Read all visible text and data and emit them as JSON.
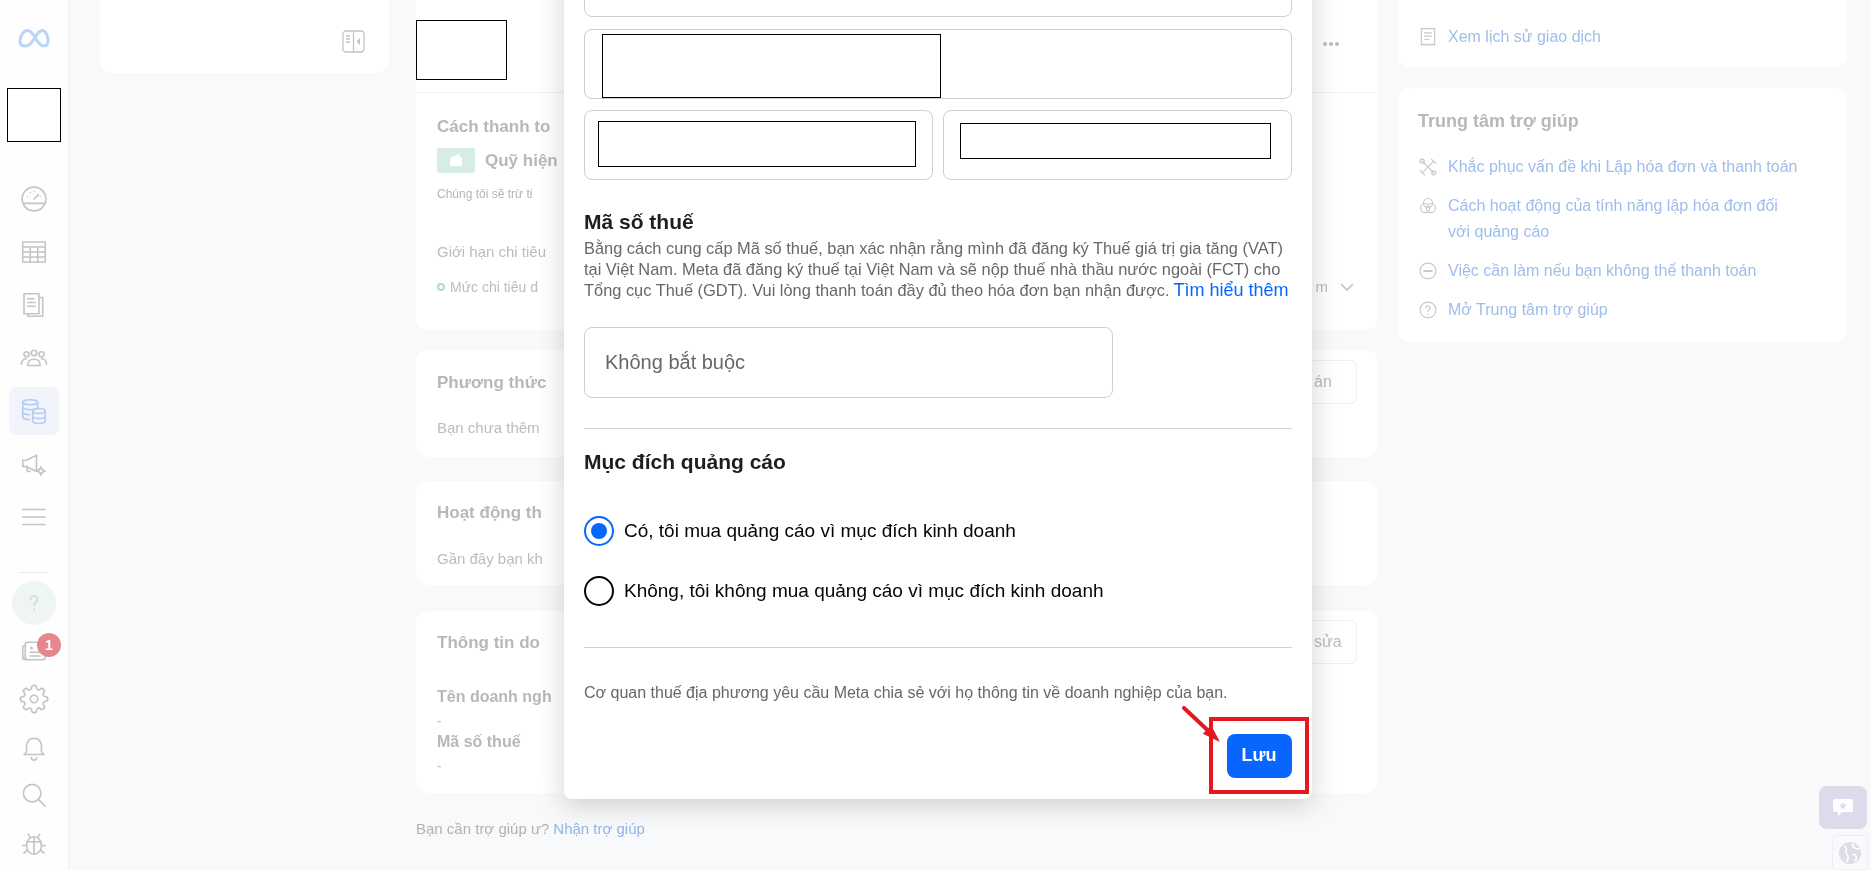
{
  "sidebar": {
    "nav_items": [
      {
        "selected": false
      },
      {
        "selected": false
      },
      {
        "selected": false
      },
      {
        "selected": false
      },
      {
        "selected": true
      },
      {
        "selected": false
      },
      {
        "selected": false
      }
    ],
    "tool_items": [
      {
        "selected": false
      },
      {
        "selected": false,
        "badge": "1"
      },
      {
        "selected": false
      },
      {
        "selected": false
      },
      {
        "selected": false
      },
      {
        "selected": false
      }
    ]
  },
  "main": {
    "payment_card": {
      "title": "Cách thanh to",
      "fund": "Quỹ hiện",
      "note": "Chúng tôi sẽ trừ ti",
      "limit_label": "Giới hạn chi tiêu",
      "spend": "Mức chi tiêu d",
      "spend_end": "m"
    },
    "payment_methods_card": {
      "title": "Phương thức",
      "text": "Bạn chưa thêm",
      "button": "án"
    },
    "activity_card": {
      "title": "Hoạt động th",
      "text": "Gần đây bạn kh"
    },
    "business_card": {
      "title": "Thông tin do",
      "button": "sửa",
      "fields": [
        {
          "label": "Tên doanh ngh",
          "value": "-"
        },
        {
          "label": "Mã số thuế",
          "value": "-"
        }
      ]
    },
    "help_prompt": {
      "text": "Bạn cần trợ giúp ư?",
      "link": "Nhận trợ giúp"
    }
  },
  "right_panel": {
    "history_link": "Xem lịch sử giao dịch",
    "help_center": {
      "title": "Trung tâm trợ giúp",
      "links": [
        "Khắc phục vấn đề khi Lập hóa đơn và thanh toán",
        "Cách hoạt động của tính năng lập hóa đơn đối với quảng cáo",
        "Việc cần làm nếu bạn không thể thanh toán",
        "Mở Trung tâm trợ giúp"
      ]
    }
  },
  "modal": {
    "field_rows": [
      {
        "fields": [
          {
            "redacted": false
          }
        ]
      },
      {
        "fields": [
          {
            "redacted": true
          }
        ]
      },
      {
        "fields": [
          {
            "redacted": true
          },
          {
            "redacted": true
          }
        ]
      }
    ],
    "tax": {
      "title": "Mã số thuế",
      "description": "Bằng cách cung cấp Mã số thuế, bạn xác nhận rằng mình đã đăng ký Thuế giá trị gia tăng (VAT) tại Việt Nam. Meta đã đăng ký thuế tại Việt Nam và sẽ nộp thuế nhà thầu nước ngoài (FCT) cho Tổng cục Thuế (GDT). Vui lòng thanh toán đầy đủ theo hóa đơn bạn nhận được.",
      "link": "Tìm hiểu thêm",
      "input": {
        "placeholder": "Không bắt buộc"
      }
    },
    "purpose": {
      "title": "Mục đích quảng cáo",
      "options": [
        {
          "label": "Có, tôi mua quảng cáo vì mục đích kinh doanh",
          "selected": true
        },
        {
          "label": "Không, tôi không mua quảng cáo vì mục đích kinh doanh",
          "selected": false
        }
      ]
    },
    "footnote": "Cơ quan thuế địa phương yêu cầu Meta chia sẻ với họ thông tin về doanh nghiệp của bạn.",
    "save_button": {
      "label": "Lưu",
      "highlighted": true
    }
  }
}
